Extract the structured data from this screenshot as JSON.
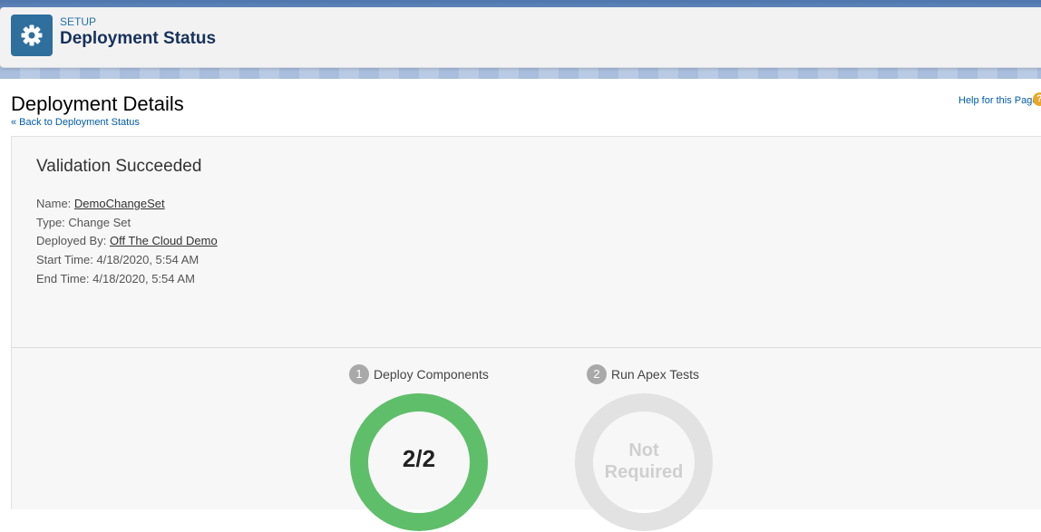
{
  "header": {
    "eyebrow": "SETUP",
    "title": "Deployment Status",
    "icon": "gear-icon"
  },
  "page": {
    "title": "Deployment Details",
    "back_link": "« Back to Deployment Status",
    "help_link": "Help for this Page",
    "help_icon": "question-icon"
  },
  "details": {
    "status": "Validation Succeeded",
    "name_label": "Name:",
    "name_value": "DemoChangeSet",
    "type_label": "Type:",
    "type_value": "Change Set",
    "deployed_by_label": "Deployed By:",
    "deployed_by_value": "Off The Cloud Demo",
    "start_label": "Start Time:",
    "start_value": "4/18/2020, 5:54 AM",
    "end_label": "End Time:",
    "end_value": "4/18/2020, 5:54 AM"
  },
  "steps": [
    {
      "number": "1",
      "label": "Deploy Components",
      "ring_text": "2/2",
      "ring_color": "#5fbe6a",
      "completed": 2,
      "total": 2
    },
    {
      "number": "2",
      "label": "Run Apex Tests",
      "ring_line1": "Not",
      "ring_line2": "Required",
      "ring_color": "#e2e2e2"
    }
  ],
  "colors": {
    "link": "#015ba7",
    "success": "#5fbe6a",
    "inactive": "#e2e2e2"
  }
}
